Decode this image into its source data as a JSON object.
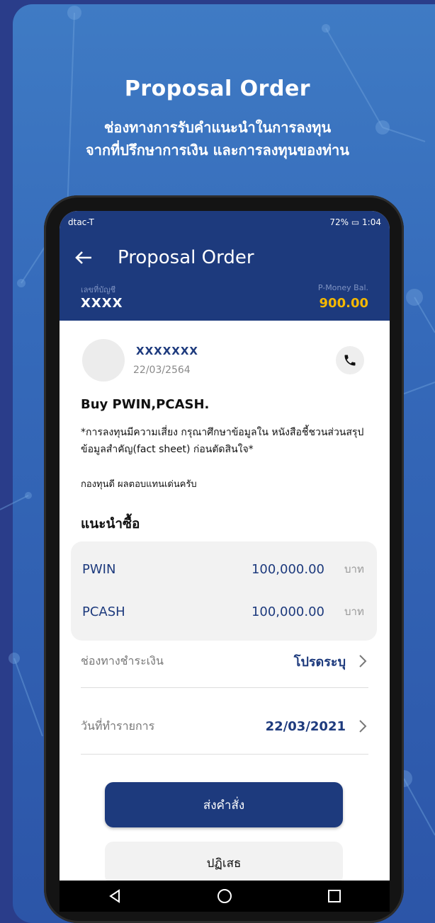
{
  "promo": {
    "title": "Proposal Order",
    "subtitle_line1": "ช่องทางการรับคำแนะนำในการลงทุน",
    "subtitle_line2": "จากที่ปรึกษาการเงิน และการลงทุนของท่าน"
  },
  "statusbar": {
    "carrier": "dtac-T",
    "battery": "72%",
    "time": "1:04"
  },
  "appbar": {
    "title": "Proposal Order"
  },
  "account": {
    "number_label": "เลขที่บัญชี",
    "number_value": "XXXX",
    "balance_label": "P-Money Bal.",
    "balance_value": "900.00"
  },
  "message": {
    "sender": "XXXXXXX",
    "date": "22/03/2564",
    "title": "Buy PWIN,PCASH.",
    "warning": "*การลงทุนมีความเสี่ยง กรุณาศึกษาข้อมูลใน หนังสือชี้ชวนส่วนสรุปข้อมูลสำคัญ(fact sheet) ก่อนตัดสินใจ*",
    "note": "กองทุนดี ผลตอบแทนเด่นครับ"
  },
  "recommend": {
    "title": "แนะนำซื้อ",
    "funds": [
      {
        "name": "PWIN",
        "amount": "100,000.00",
        "unit": "บาท"
      },
      {
        "name": "PCASH",
        "amount": "100,000.00",
        "unit": "บาท"
      }
    ]
  },
  "options": {
    "payment_label": "ช่องทางชำระเงิน",
    "payment_value": "โปรดระบุ",
    "date_label": "วันที่ทำรายการ",
    "date_value": "22/03/2021"
  },
  "buttons": {
    "submit": "ส่งคำสั่ง",
    "reject": "ปฏิเสธ"
  },
  "colors": {
    "primary": "#1d3a7d",
    "balance": "#f5b800",
    "background": "#2a3d8a"
  }
}
